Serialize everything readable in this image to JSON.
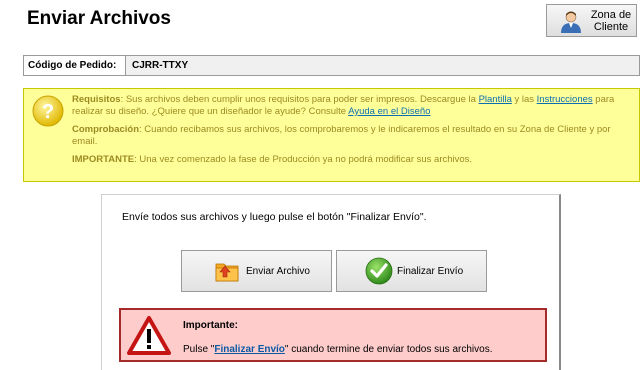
{
  "page": {
    "title": "Enviar Archivos"
  },
  "zone_button": {
    "line1": "Zona de",
    "line2": "Cliente",
    "icon": "user-icon"
  },
  "order": {
    "label": "Código de Pedido:",
    "value": "CJRR-TTXY"
  },
  "info": {
    "icon": "question-icon",
    "req_label": "Requisitos",
    "req_text_1": ": Sus archivos deben cumplir unos requisitos para poder ser impresos. Descargue la ",
    "req_link_template": "Plantilla",
    "req_text_2": " y las ",
    "req_link_instructions": "Instrucciones",
    "req_text_3": " para realizar su diseño. ¿Quiere que un diseñador le ayude? Consulte ",
    "req_link_help": "Ayuda en el Diseño",
    "check_label": "Comprobación",
    "check_text": ": Cuando recibamos sus archivos, los comprobaremos y le indicaremos el resultado en su Zona de Cliente y por email.",
    "important_label": "IMPORTANTE",
    "important_text": ": Una vez comenzado la fase de Producción ya no podrá modificar sus archivos."
  },
  "panel": {
    "instruction": "Envíe todos sus archivos y luego pulse el botón \"Finalizar Envío\".",
    "send_button": "Enviar Archivo",
    "finish_button": "Finalizar Envío"
  },
  "alert": {
    "icon": "warning-icon",
    "title": "Importante:",
    "text_1": "Pulse \"",
    "link": "Finalizar Envío",
    "text_2": "\" cuando termine de enviar todos sus archivos."
  }
}
